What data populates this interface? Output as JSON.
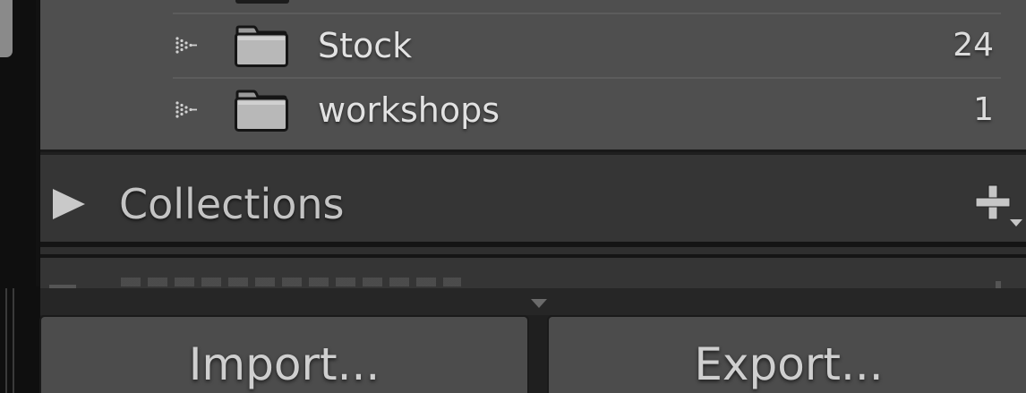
{
  "folders": {
    "items": [
      {
        "name": "Stock",
        "count": "24"
      },
      {
        "name": "workshops",
        "count": "1"
      }
    ]
  },
  "collections": {
    "title": "Collections",
    "add_icon": "plus-icon"
  },
  "actions": {
    "import_label": "Import...",
    "export_label": "Export..."
  },
  "colors": {
    "panel_bg": "#4f4f4f",
    "header_bg": "#353535",
    "text": "#e2e2e2"
  }
}
